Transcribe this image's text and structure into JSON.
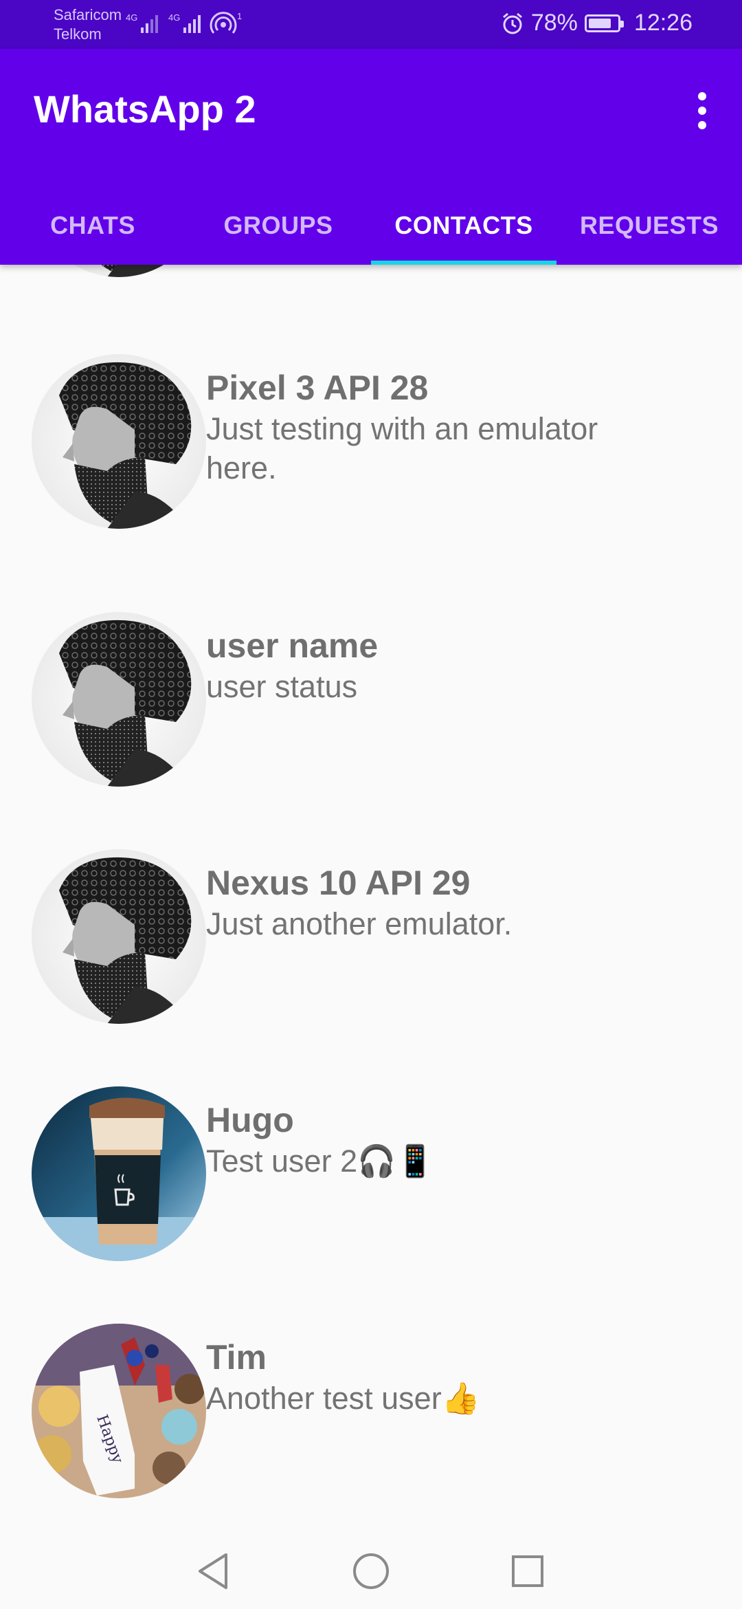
{
  "status_bar": {
    "carrier_1": "Safaricom",
    "carrier_2": "Telkom",
    "net_1": "4G",
    "net_2": "4G",
    "hotspot_count": "1",
    "battery": "78%",
    "time": "12:26"
  },
  "app_bar": {
    "title": "WhatsApp 2",
    "menu_icon": "more-vert-icon"
  },
  "tabs": [
    {
      "label": "CHATS",
      "active": false
    },
    {
      "label": "GROUPS",
      "active": false
    },
    {
      "label": "CONTACTS",
      "active": true
    },
    {
      "label": "REQUESTS",
      "active": false
    }
  ],
  "contacts": [
    {
      "name": "Pixel 3 API 28",
      "status": "Just testing with an emulator here.",
      "avatar": "curly-hair-man-portrait"
    },
    {
      "name": "user name",
      "status": "user status",
      "avatar": "curly-hair-man-portrait"
    },
    {
      "name": "Nexus 10 API 29",
      "status": "Just another emulator.",
      "avatar": "curly-hair-man-portrait"
    },
    {
      "name": "Hugo",
      "status": "Test user 2🎧📱",
      "avatar": "coffee-cup-photo"
    },
    {
      "name": "Tim",
      "status": "Another test user👍",
      "avatar": "birthday-cake-photo"
    }
  ],
  "nav_bar": {
    "back_icon": "back-triangle-icon",
    "home_icon": "home-circle-icon",
    "recents_icon": "recents-square-icon"
  },
  "colors": {
    "status_bar": "#4b05c4",
    "app_bar": "#6200ea",
    "tab_indicator": "#19d4e6",
    "background": "#fafafa"
  }
}
